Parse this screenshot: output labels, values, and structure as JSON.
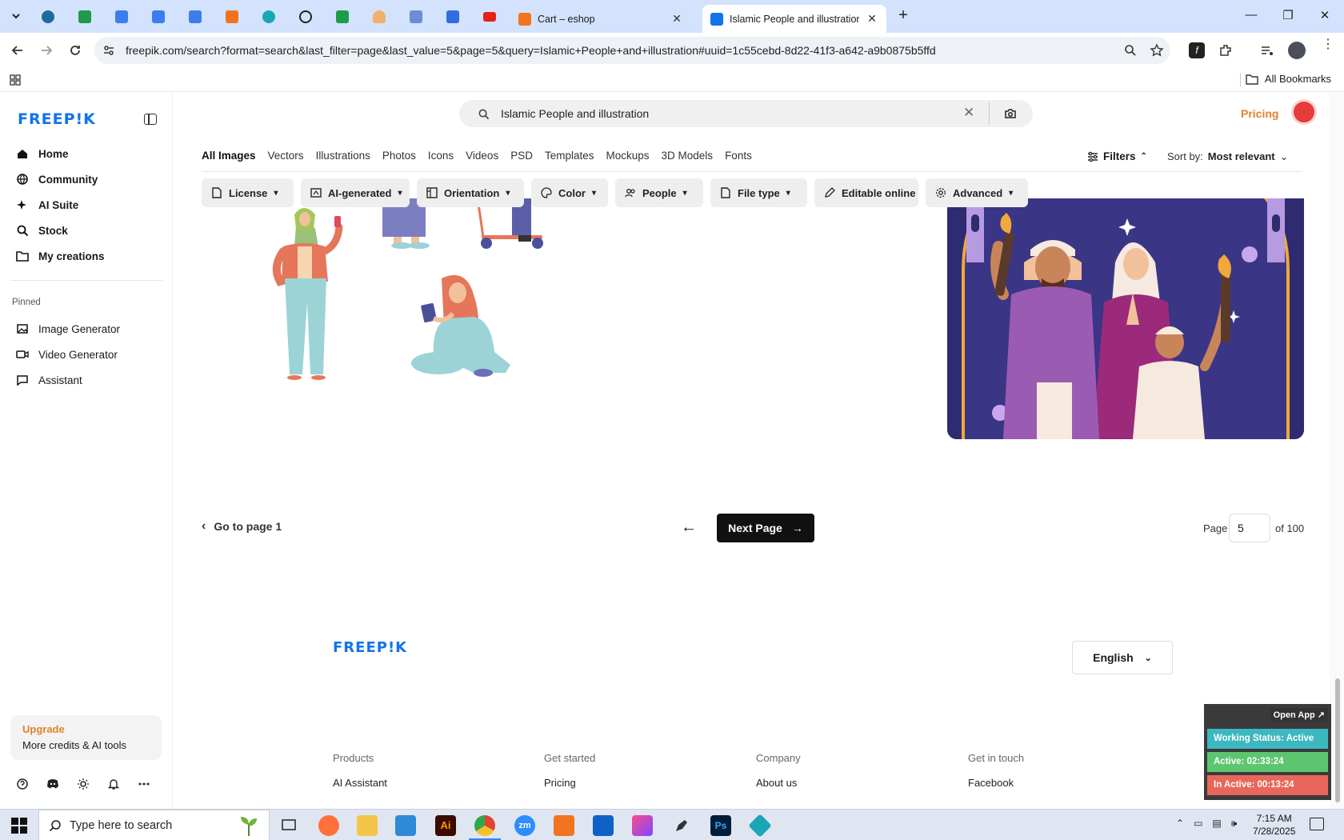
{
  "browser": {
    "tabs": [
      {
        "title": "Cart – eshop"
      },
      {
        "title": "Islamic People and illustration"
      }
    ],
    "url": "freepik.com/search?format=search&last_filter=page&last_value=5&page=5&query=Islamic+People+and+illustration#uuid=1c55cebd-8d22-41f3-a642-a9b0875b5ffd",
    "bookmarks_label": "All Bookmarks"
  },
  "sidebar": {
    "logo": "FREEP!K",
    "nav": [
      {
        "label": "Home",
        "icon": "home-icon"
      },
      {
        "label": "Community",
        "icon": "globe-icon"
      },
      {
        "label": "AI Suite",
        "icon": "sparkle-icon"
      },
      {
        "label": "Stock",
        "icon": "search-icon"
      },
      {
        "label": "My creations",
        "icon": "folder-icon"
      }
    ],
    "pinned_heading": "Pinned",
    "pinned": [
      {
        "label": "Image Generator",
        "icon": "image-icon"
      },
      {
        "label": "Video Generator",
        "icon": "video-icon"
      },
      {
        "label": "Assistant",
        "icon": "chat-icon"
      }
    ],
    "upgrade": {
      "title": "Upgrade",
      "subtitle": "More credits & AI tools"
    }
  },
  "header": {
    "search_value": "Islamic People and illustration",
    "pricing": "Pricing"
  },
  "type_tabs": [
    "All Images",
    "Vectors",
    "Illustrations",
    "Photos",
    "Icons",
    "Videos",
    "PSD",
    "Templates",
    "Mockups",
    "3D Models",
    "Fonts"
  ],
  "active_type_tab": "All Images",
  "filters_label": "Filters",
  "sort": {
    "label": "Sort by:",
    "value": "Most relevant"
  },
  "chips": [
    "License",
    "AI-generated",
    "Orientation",
    "Color",
    "People",
    "File type",
    "Editable online",
    "Advanced"
  ],
  "pagination": {
    "goto_first": "Go to page 1",
    "next": "Next Page",
    "page_label": "Page",
    "current_page": "5",
    "of_label": "of 100"
  },
  "footer": {
    "logo": "FREEP!K",
    "language": "English",
    "columns": [
      {
        "heading": "Products",
        "link": "AI Assistant"
      },
      {
        "heading": "Get started",
        "link": "Pricing"
      },
      {
        "heading": "Company",
        "link": "About us"
      },
      {
        "heading": "Get in touch",
        "link": "Facebook"
      }
    ]
  },
  "tracker": {
    "open_app": "Open App ↗",
    "status": "Working Status: Active",
    "active": "Active: 02:33:24",
    "inactive": "In Active: 00:13:24"
  },
  "taskbar": {
    "search_placeholder": "Type here to search",
    "time": "7:15 AM",
    "date": "7/28/2025"
  },
  "colors": {
    "brand_blue": "#1273eb",
    "pricing_orange": "#e0832b",
    "tracker_green": "#5dc56f",
    "tracker_red": "#e8675a",
    "tracker_teal": "#3cb8c0"
  }
}
